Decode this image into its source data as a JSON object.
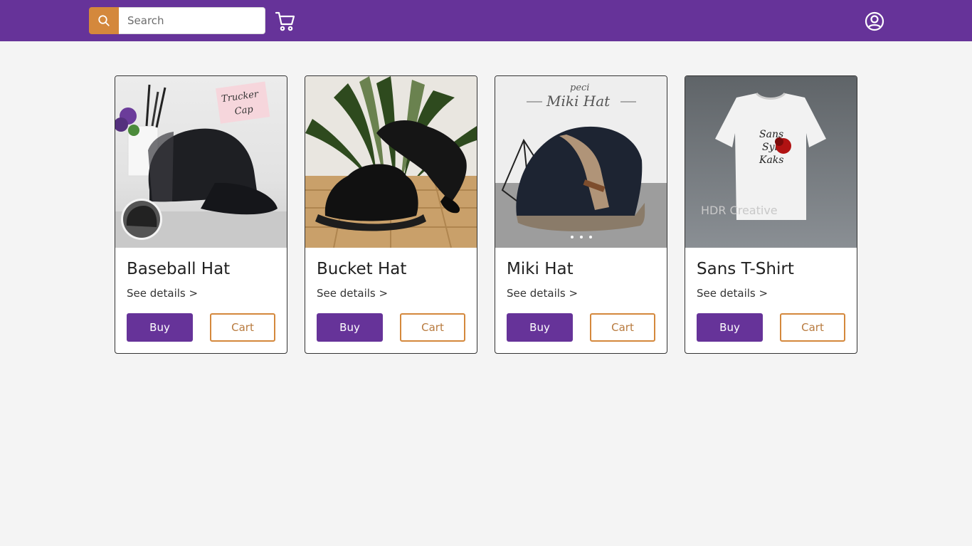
{
  "header": {
    "search_placeholder": "Search",
    "colors": {
      "bar": "#663399",
      "search_button": "#d4883c"
    },
    "icons": [
      "search-icon",
      "shopping-cart-icon",
      "user-account-icon"
    ]
  },
  "products": [
    {
      "name": "Baseball Hat",
      "details_label": "See details >",
      "buy_label": "Buy",
      "cart_label": "Cart",
      "image_text": [
        "Trucker",
        "Cap"
      ]
    },
    {
      "name": "Bucket Hat",
      "details_label": "See details >",
      "buy_label": "Buy",
      "cart_label": "Cart"
    },
    {
      "name": "Miki Hat",
      "details_label": "See details >",
      "buy_label": "Buy",
      "cart_label": "Cart",
      "image_text": [
        "peci",
        "Miki Hat"
      ]
    },
    {
      "name": "Sans T-Shirt",
      "details_label": "See details >",
      "buy_label": "Buy",
      "cart_label": "Cart",
      "image_text": [
        "Sans",
        "Syl",
        "Kaks",
        "HDR Creative"
      ]
    }
  ]
}
